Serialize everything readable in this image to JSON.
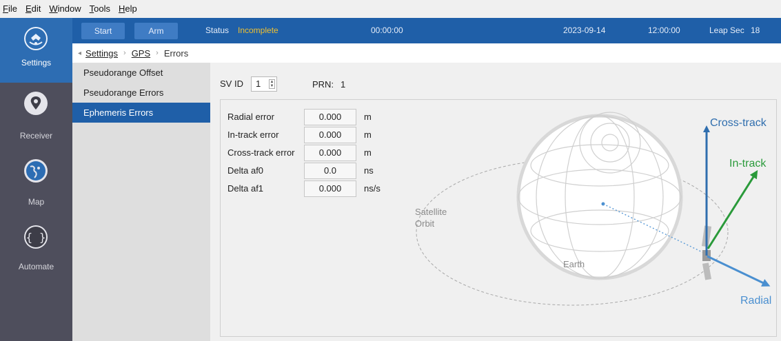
{
  "menu": [
    {
      "pre": "",
      "u": "F",
      "post": "ile"
    },
    {
      "pre": "",
      "u": "E",
      "post": "dit"
    },
    {
      "pre": "",
      "u": "W",
      "post": "indow"
    },
    {
      "pre": "",
      "u": "T",
      "post": "ools"
    },
    {
      "pre": "",
      "u": "H",
      "post": "elp"
    }
  ],
  "rail": {
    "items": [
      {
        "label": "Settings",
        "icon": "satellite-icon",
        "active": true
      },
      {
        "label": "Receiver",
        "icon": "location-pin-icon",
        "active": false
      },
      {
        "label": "Map",
        "icon": "globe-icon",
        "active": false
      },
      {
        "label": "Automate",
        "icon": "braces-icon",
        "active": false
      }
    ]
  },
  "toolbar": {
    "start_label": "Start",
    "arm_label": "Arm",
    "status_label": "Status",
    "status_value": "Incomplete",
    "elapsed": "00:00:00",
    "date": "2023-09-14",
    "time": "12:00:00",
    "leap_label": "Leap Sec",
    "leap_value": "18",
    "colors": {
      "bar": "#1f5fa8",
      "status_value": "#f0c030"
    }
  },
  "breadcrumb": {
    "back_glyph": "◂",
    "items": [
      "Settings",
      "GPS",
      "Errors"
    ],
    "sep": "›"
  },
  "submenu": {
    "items": [
      "Pseudorange Offset",
      "Pseudorange Errors",
      "Ephemeris Errors"
    ],
    "active_index": 2
  },
  "content": {
    "svid_label": "SV ID",
    "svid_value": "1",
    "prn_label": "PRN:",
    "prn_value": "1",
    "fields": [
      {
        "label": "Radial error",
        "value": "0.000",
        "unit": "m"
      },
      {
        "label": "In-track error",
        "value": "0.000",
        "unit": "m"
      },
      {
        "label": "Cross-track error",
        "value": "0.000",
        "unit": "m"
      },
      {
        "label": "Delta af0",
        "value": "0.0",
        "unit": "ns"
      },
      {
        "label": "Delta af1",
        "value": "0.000",
        "unit": "ns/s"
      }
    ]
  },
  "diagram": {
    "orbit_label_1": "Satellite",
    "orbit_label_2": "Orbit",
    "earth_label": "Earth",
    "cross_track_label": "Cross-track",
    "in_track_label": "In-track",
    "radial_label": "Radial",
    "colors": {
      "cross_track": "#2f6eae",
      "in_track": "#2a9a3a",
      "radial": "#4a8fd0"
    }
  }
}
